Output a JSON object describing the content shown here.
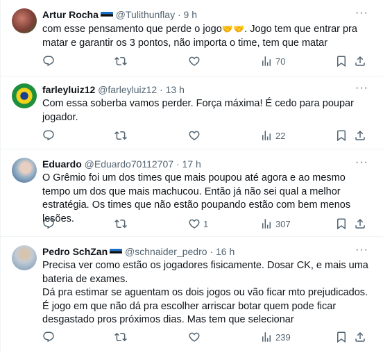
{
  "tweets": [
    {
      "name": "Artur Rocha",
      "handle": "@Tulithunflay",
      "time": "9 h",
      "has_flag": true,
      "text_before": "com esse pensamento que perde o jogo",
      "emojis": "🤝🤝",
      "text_after": ". Jogo tem que entrar pra matar e garantir os 3 pontos, não importa o time, tem que matar",
      "views": "70",
      "likes": ""
    },
    {
      "name": "farleyluiz12",
      "handle": "@farleyluiz12",
      "time": "13 h",
      "has_flag": false,
      "text_before": "Com essa soberba vamos perder. Força máxima! É cedo para poupar jogador.",
      "views": "22",
      "likes": ""
    },
    {
      "name": "Eduardo",
      "handle": "@Eduardo70112707",
      "time": "17 h",
      "has_flag": false,
      "text_before": "O Grêmio foi um dos times que mais poupou até agora e ao mesmo tempo um dos que mais machucou. Então já não sei qual a melhor estratégia. Os times que não estão poupando estão com bem menos lesões.",
      "views": "307",
      "likes": "1"
    },
    {
      "name": "Pedro SchZan",
      "handle": "@schnaider_pedro",
      "time": "16 h",
      "has_flag": true,
      "text_lines": [
        "Precisa ver como estão os jogadores fisicamente. Dosar CK, e mais uma bateria de exames.",
        "Dá pra estimar se aguentam os dois jogos ou vão ficar mto prejudicados.",
        "É jogo em que não dá pra escolher arriscar botar quem pode ficar desgastado pros próximos dias. Mas tem que selecionar"
      ],
      "views": "239",
      "likes": ""
    }
  ],
  "separator": "·",
  "colors": {
    "text": "#0f1419",
    "muted": "#536471",
    "border": "#eff3f4"
  },
  "icons": [
    "reply-icon",
    "retweet-icon",
    "like-icon",
    "views-icon",
    "bookmark-icon",
    "share-icon",
    "more-icon"
  ]
}
